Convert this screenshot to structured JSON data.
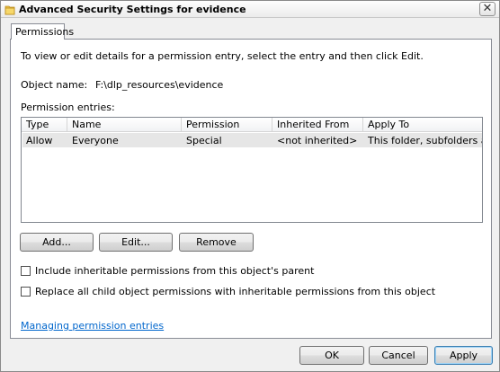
{
  "window": {
    "title": "Advanced Security Settings for evidence",
    "close_glyph": "✕"
  },
  "tabs": [
    {
      "label": "Permissions"
    }
  ],
  "permissions": {
    "instruction": "To view or edit details for a permission entry, select the entry and then click Edit.",
    "object_name_label": "Object name:",
    "object_name_value": "F:\\dlp_resources\\evidence",
    "entries_label": "Permission entries:",
    "columns": [
      "Type",
      "Name",
      "Permission",
      "Inherited From",
      "Apply To"
    ],
    "rows": [
      {
        "type": "Allow",
        "name": "Everyone",
        "permission": "Special",
        "inherited_from": "<not inherited>",
        "apply_to": "This folder, subfolders a..."
      }
    ],
    "buttons": {
      "add": "Add...",
      "edit": "Edit...",
      "remove": "Remove"
    },
    "checkboxes": {
      "include_inheritable": "Include inheritable permissions from this object's parent",
      "replace_child": "Replace all child object permissions with inheritable permissions from this object"
    },
    "link": "Managing permission entries"
  },
  "footer": {
    "ok": "OK",
    "cancel": "Cancel",
    "apply": "Apply"
  }
}
